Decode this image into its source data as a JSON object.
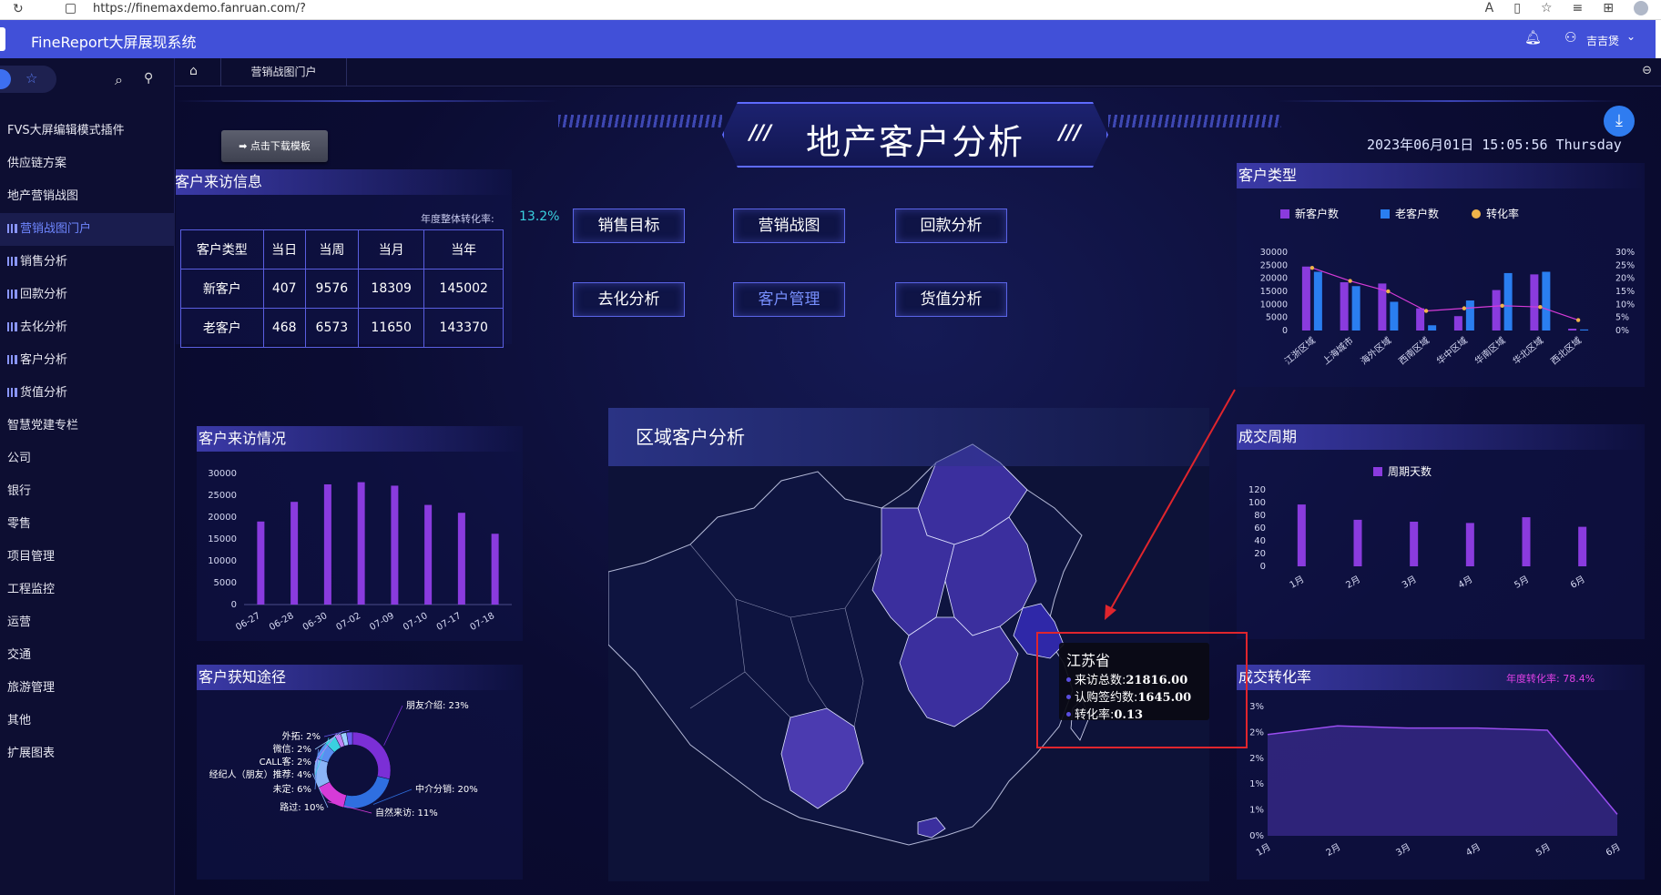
{
  "browser": {
    "url": "https://finemaxdemo.fanruan.com/?"
  },
  "header": {
    "title": "FineReport大屏展现系统",
    "username": "吉吉煲"
  },
  "sidebar": {
    "items": [
      {
        "label": "FVS大屏编辑模式插件",
        "icon": false
      },
      {
        "label": "供应链方案",
        "icon": false
      },
      {
        "label": "地产营销战图",
        "icon": false
      },
      {
        "label": "营销战图门户",
        "icon": true,
        "active": true
      },
      {
        "label": "销售分析",
        "icon": true
      },
      {
        "label": "回款分析",
        "icon": true
      },
      {
        "label": "去化分析",
        "icon": true
      },
      {
        "label": "客户分析",
        "icon": true
      },
      {
        "label": "货值分析",
        "icon": true
      },
      {
        "label": "智慧党建专栏",
        "icon": false
      },
      {
        "label": "公司",
        "icon": false
      },
      {
        "label": "银行",
        "icon": false
      },
      {
        "label": "零售",
        "icon": false
      },
      {
        "label": "项目管理",
        "icon": false
      },
      {
        "label": "工程监控",
        "icon": false
      },
      {
        "label": "运营",
        "icon": false
      },
      {
        "label": "交通",
        "icon": false
      },
      {
        "label": "旅游管理",
        "icon": false
      },
      {
        "label": "其他",
        "icon": false
      },
      {
        "label": "扩展图表",
        "icon": false
      }
    ]
  },
  "tabbar": {
    "tab": "营销战图门户"
  },
  "dashboard": {
    "title": "地产客户分析",
    "slashes": "///",
    "download_label": "➡ 点击下载模板",
    "datetime": "2023年06月01日 15:05:56 Thursday",
    "colors": {
      "accent": "#4150d8",
      "purple_bar": "#8a3bde",
      "blue_bar": "#2a7ef0",
      "cyan": "#3ad1e0",
      "magenta": "#d63bd8"
    }
  },
  "visit_info": {
    "title": "客户来访信息",
    "rate_label": "年度整体转化率:",
    "rate_value": "13.2%",
    "headers": [
      "客户类型",
      "当日",
      "当周",
      "当月",
      "当年"
    ],
    "rows": [
      [
        "新客户",
        "407",
        "9576",
        "18309",
        "145002"
      ],
      [
        "老客户",
        "468",
        "6573",
        "11650",
        "143370"
      ]
    ]
  },
  "nav_buttons": [
    {
      "label": "销售目标"
    },
    {
      "label": "营销战图"
    },
    {
      "label": "回款分析"
    },
    {
      "label": "去化分析"
    },
    {
      "label": "客户管理",
      "active": true
    },
    {
      "label": "货值分析"
    }
  ],
  "visit_trend": {
    "title": "客户来访情况"
  },
  "channels": {
    "title": "客户获知途径"
  },
  "map": {
    "title": "区域客户分析",
    "tooltip": {
      "province": "江苏省",
      "rows": [
        {
          "label": "来访总数:",
          "value": "21816.00"
        },
        {
          "label": "认购签约数:",
          "value": "1645.00"
        },
        {
          "label": "转化率:",
          "value": "0.13"
        }
      ]
    }
  },
  "customer_type": {
    "title": "客户类型"
  },
  "deal_cycle": {
    "title": "成交周期"
  },
  "conversion": {
    "title": "成交转化率",
    "annual_label": "年度转化率:  78.4%"
  },
  "chart_data": [
    {
      "id": "visits",
      "type": "bar",
      "title": "客户来访情况",
      "categories": [
        "06-27",
        "06-28",
        "06-30",
        "07-02",
        "07-09",
        "07-10",
        "07-17",
        "07-18"
      ],
      "values": [
        19000,
        23500,
        27500,
        28000,
        27200,
        22800,
        21000,
        16200
      ],
      "yticks": [
        "0",
        "5000",
        "10000",
        "15000",
        "20000",
        "25000",
        "30000"
      ],
      "ylim": [
        0,
        30000
      ],
      "color": "#8a3bde"
    },
    {
      "id": "channels",
      "type": "pie",
      "title": "客户获知途径",
      "slices": [
        {
          "name": "朋友介绍",
          "label": "朋友介绍:  23%",
          "value": 23,
          "color": "#7b2fd6"
        },
        {
          "name": "中介分销",
          "label": "中介分销:  20%",
          "value": 20,
          "color": "#2f6fe0"
        },
        {
          "name": "自然来访",
          "label": "自然来访:  11%",
          "value": 11,
          "color": "#d63bd8"
        },
        {
          "name": "路过",
          "label": "路过:  10%",
          "value": 10,
          "color": "#8ab4f8"
        },
        {
          "name": "未定",
          "label": "未定:  6%",
          "value": 6,
          "color": "#5a8ef0"
        },
        {
          "name": "经纪人（朋友）推荐",
          "label": "经纪人（朋友）推荐:  4%",
          "value": 4,
          "color": "#3ad1e0"
        },
        {
          "name": "CALL客",
          "label": "CALL客:  2%",
          "value": 2,
          "color": "#c084f5"
        },
        {
          "name": "微信",
          "label": "微信:  2%",
          "value": 2,
          "color": "#9cd0ff"
        },
        {
          "name": "外拓",
          "label": "外拓:  2%",
          "value": 2,
          "color": "#6a5af0"
        }
      ]
    },
    {
      "id": "customer_type",
      "type": "bar",
      "title": "客户类型",
      "categories": [
        "江浙区域",
        "上海城市",
        "海外区域",
        "西南区域",
        "华中区域",
        "华南区域",
        "华北区域",
        "西北区域"
      ],
      "series": [
        {
          "name": "新客户数",
          "values": [
            24500,
            18500,
            18000,
            8500,
            5500,
            15500,
            21500,
            700
          ],
          "color": "#8a3bde"
        },
        {
          "name": "老客户数",
          "values": [
            22500,
            17000,
            11000,
            2000,
            11500,
            22000,
            22500,
            400
          ],
          "color": "#2a7ef0"
        },
        {
          "name": "转化率",
          "values": [
            24,
            19,
            15,
            7.5,
            8.5,
            9.5,
            9,
            4
          ],
          "color": "#f0b44a",
          "axis": "right"
        }
      ],
      "yticks_left": [
        "0",
        "5000",
        "10000",
        "15000",
        "20000",
        "25000",
        "30000"
      ],
      "yticks_right": [
        "0%",
        "5%",
        "10%",
        "15%",
        "20%",
        "25%",
        "30%"
      ],
      "ylim": [
        0,
        30000
      ],
      "ylim_right": [
        0,
        30
      ]
    },
    {
      "id": "deal_cycle",
      "type": "bar",
      "title": "成交周期",
      "categories": [
        "1月",
        "2月",
        "3月",
        "4月",
        "5月",
        "6月"
      ],
      "series": [
        {
          "name": "周期天数",
          "values": [
            97,
            73,
            70,
            68,
            77,
            62
          ],
          "color": "#8a3bde"
        }
      ],
      "yticks": [
        "0",
        "20",
        "40",
        "60",
        "80",
        "100",
        "120"
      ],
      "ylim": [
        0,
        120
      ]
    },
    {
      "id": "conversion",
      "type": "area",
      "title": "成交转化率",
      "categories": [
        "1月",
        "2月",
        "3月",
        "4月",
        "5月",
        "6月"
      ],
      "values": [
        2.35,
        2.55,
        2.5,
        2.5,
        2.45,
        0.5
      ],
      "yticks": [
        "0%",
        "1%",
        "1%",
        "2%",
        "2%",
        "3%"
      ],
      "ylim": [
        0,
        3
      ],
      "color": "#9a4ef0"
    }
  ]
}
